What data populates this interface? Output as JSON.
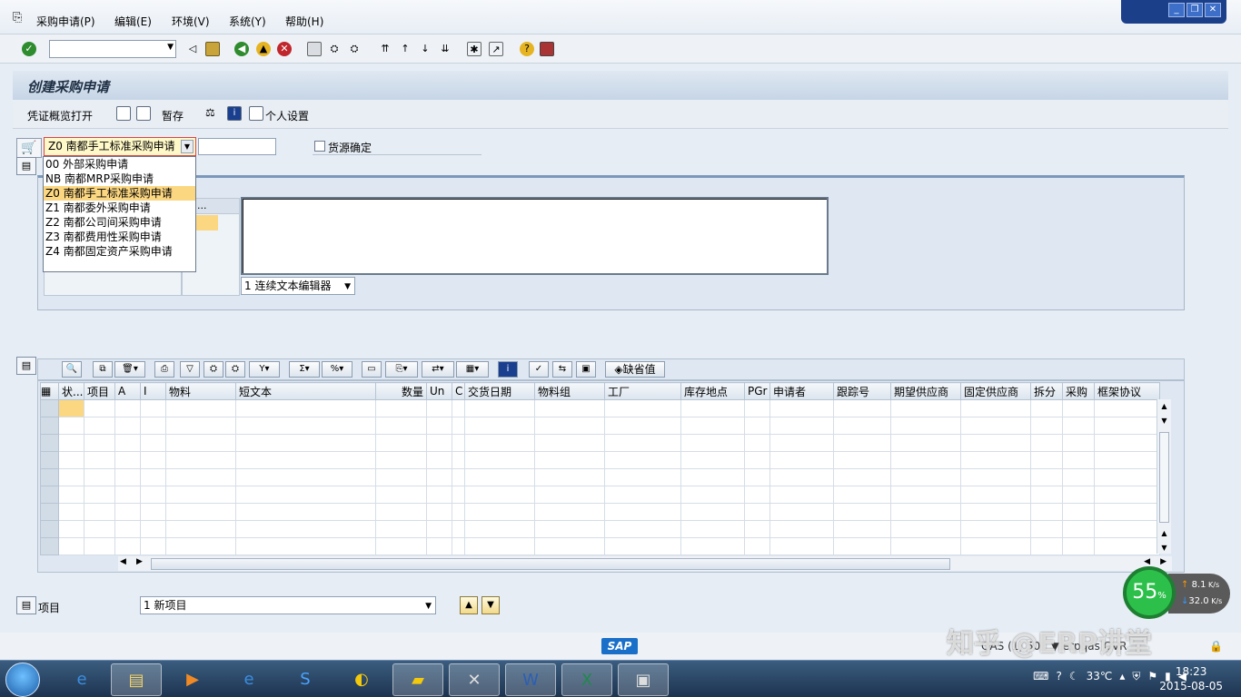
{
  "menu": {
    "items": [
      "采购申请(P)",
      "编辑(E)",
      "环境(V)",
      "系统(Y)",
      "帮助(H)"
    ]
  },
  "window_controls": [
    "minimize",
    "restore",
    "close"
  ],
  "title": "创建采购申请",
  "app_toolbar": {
    "doc_overview": "凭证概览打开",
    "hold": "暂存",
    "personal_settings": "个人设置"
  },
  "doc_type": {
    "selected": "Z0 南都手工标准采购申请",
    "options": [
      {
        "code": "00",
        "label": "外部采购申请"
      },
      {
        "code": "NB",
        "label": "南都MRP采购申请"
      },
      {
        "code": "Z0",
        "label": "南都手工标准采购申请"
      },
      {
        "code": "Z1",
        "label": "南都委外采购申请"
      },
      {
        "code": "Z2",
        "label": "南都公司间采购申请"
      },
      {
        "code": "Z3",
        "label": "南都费用性采购申请"
      },
      {
        "code": "Z4",
        "label": "南都固定资产采购申请"
      }
    ]
  },
  "source_determination": "货源确定",
  "header_col": "...",
  "text_editor_select": "1 连续文本编辑器",
  "grid": {
    "default_button": "缺省值",
    "columns": [
      "状...",
      "项目",
      "A",
      "I",
      "物料",
      "短文本",
      "数量",
      "Un",
      "C",
      "交货日期",
      "物料组",
      "工厂",
      "库存地点",
      "PGr",
      "申请者",
      "跟踪号",
      "期望供应商",
      "固定供应商",
      "拆分",
      "采购",
      "框架协议"
    ]
  },
  "item_label": "项目",
  "item_select": "1 新项目",
  "status": {
    "logo": "SAP",
    "text": "QAS (1) 501 ▼ erpqas  OVR"
  },
  "watermark": "知乎 @ERP讲堂",
  "net": {
    "percent": "55",
    "percent_unit": "%",
    "up": "8.1",
    "down": "32.0",
    "unit": "K/s"
  },
  "taskbar": {
    "temperature": "33℃",
    "time": "18:23",
    "date": "2015-08-05"
  }
}
